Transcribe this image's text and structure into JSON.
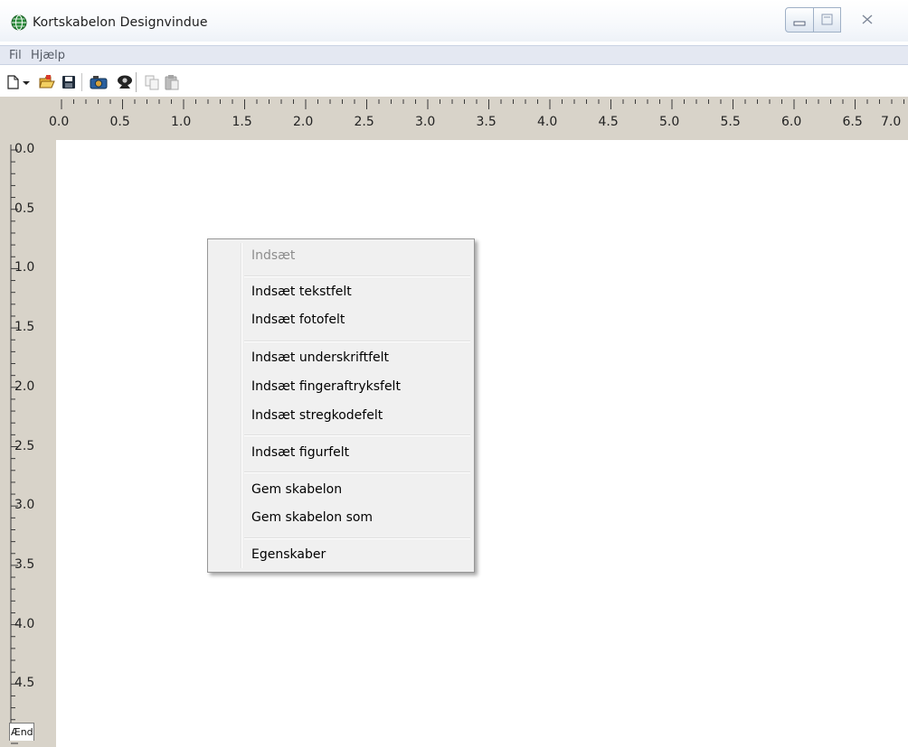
{
  "window": {
    "title": "Kortskabelon Designvindue",
    "icon": "globe-icon"
  },
  "menubar": {
    "items": [
      "Fil",
      "Hjælp"
    ]
  },
  "toolbar": {
    "icons": [
      "new-document-icon",
      "dropdown-arrow-icon",
      "open-folder-icon",
      "save-icon",
      "camera-icon",
      "webcam-icon",
      "copy-icon",
      "paste-icon"
    ]
  },
  "rulers": {
    "horizontal_labels": [
      "0.0",
      "0.5",
      "1.0",
      "1.5",
      "2.0",
      "2.5",
      "3.0",
      "3.5",
      "4.0",
      "4.5",
      "5.0",
      "5.5",
      "6.0",
      "6.5",
      "7.0"
    ],
    "vertical_labels": [
      "0.0",
      "0.5",
      "1.0",
      "1.5",
      "2.0",
      "2.5",
      "3.0",
      "3.5",
      "4.0",
      "4.5"
    ]
  },
  "context_menu": {
    "header": "Indsæt",
    "groups": [
      [
        "Indsæt tekstfelt",
        "Indsæt fotofelt"
      ],
      [
        "Indsæt underskriftfelt",
        "Indsæt fingeraftryksfelt",
        "Indsæt stregkodefelt"
      ],
      [
        "Indsæt figurfelt"
      ],
      [
        "Gem skabelon",
        "Gem skabelon som"
      ],
      [
        "Egenskaber"
      ]
    ]
  },
  "status_tab": {
    "label": "Ændring"
  },
  "colors": {
    "ruler_bg": "#d8d3c9",
    "menubar_bg": "#e4e8f2",
    "context_menu_bg": "#f0f0f0"
  }
}
